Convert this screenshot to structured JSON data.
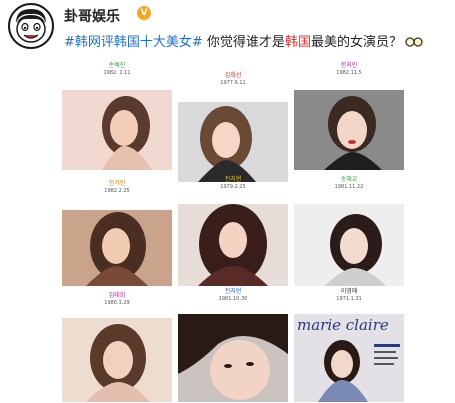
{
  "post": {
    "username": "卦哥娱乐",
    "verified_badge": "V",
    "hashtag": "#韩网评韩国十大美女#",
    "text_before": " 你觉得谁才是",
    "keyword": "韩国",
    "text_after": "最美的女演员？",
    "emoji": "glasses-emoji",
    "avatar_icon": "cartoon-face-avatar"
  },
  "grid": {
    "items": [
      {
        "name": "손예진",
        "date": "1982. 1.11",
        "name_color": "#2e9b4a"
      },
      {
        "name": "김희선",
        "date": "1977.6.11",
        "name_color": "#d0302a"
      },
      {
        "name": "한지민",
        "date": "1982.11.5",
        "name_color": "#b0238c"
      },
      {
        "name": "한가인",
        "date": "1982.2.25",
        "name_color": "#e07b1a"
      },
      {
        "name": "전지현",
        "date": "1979.2.25",
        "name_color": "#e8c21a"
      },
      {
        "name": "송혜교",
        "date": "1981.11.22",
        "name_color": "#2e9b4a"
      },
      {
        "name": "김태희",
        "date": "1980.3.29",
        "name_color": "#b0238c"
      },
      {
        "name": "전지현",
        "date": "1981.10.30",
        "name_color": "#1d6fc9"
      },
      {
        "name": "이영애",
        "date": "1971.1.31",
        "name_color": "#333333"
      }
    ],
    "magazine_title": "marie claire"
  }
}
